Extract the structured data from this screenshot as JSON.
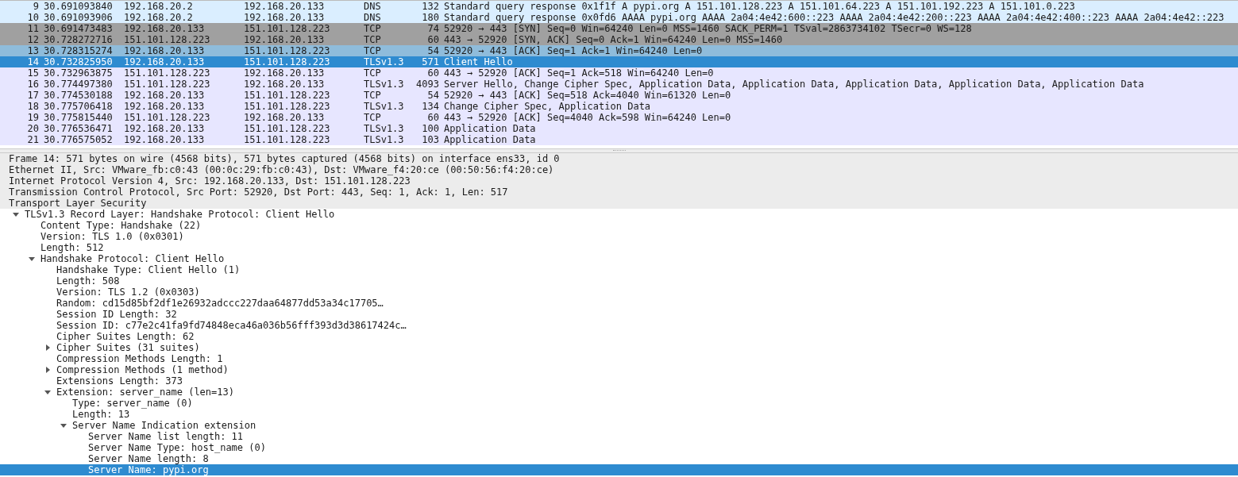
{
  "packets": [
    {
      "no": "9",
      "time": "30.691093840",
      "source": "192.168.20.2",
      "destination": "192.168.20.133",
      "protocol": "DNS",
      "length": "132",
      "info": "Standard query response 0x1f1f A pypi.org A 151.101.128.223 A 151.101.64.223 A 151.101.192.223 A 151.101.0.223",
      "color": "#daeeff",
      "selected": false
    },
    {
      "no": "10",
      "time": "30.691093906",
      "source": "192.168.20.2",
      "destination": "192.168.20.133",
      "protocol": "DNS",
      "length": "180",
      "info": "Standard query response 0x0fd6 AAAA pypi.org AAAA 2a04:4e42:600::223 AAAA 2a04:4e42:200::223 AAAA 2a04:4e42:400::223 AAAA 2a04:4e42::223",
      "color": "#daeeff",
      "selected": false
    },
    {
      "no": "11",
      "time": "30.691473483",
      "source": "192.168.20.133",
      "destination": "151.101.128.223",
      "protocol": "TCP",
      "length": "74",
      "info": "52920 → 443 [SYN] Seq=0 Win=64240 Len=0 MSS=1460 SACK_PERM=1 TSval=2863734102 TSecr=0 WS=128",
      "color": "#a0a0a0",
      "selected": false
    },
    {
      "no": "12",
      "time": "30.728272716",
      "source": "151.101.128.223",
      "destination": "192.168.20.133",
      "protocol": "TCP",
      "length": "60",
      "info": "443 → 52920 [SYN, ACK] Seq=0 Ack=1 Win=64240 Len=0 MSS=1460",
      "color": "#a0a0a0",
      "selected": false
    },
    {
      "no": "13",
      "time": "30.728315274",
      "source": "192.168.20.133",
      "destination": "151.101.128.223",
      "protocol": "TCP",
      "length": "54",
      "info": "52920 → 443 [ACK] Seq=1 Ack=1 Win=64240 Len=0",
      "color": "#8fbcdb",
      "selected": false
    },
    {
      "no": "14",
      "time": "30.732825950",
      "source": "192.168.20.133",
      "destination": "151.101.128.223",
      "protocol": "TLSv1.3",
      "length": "571",
      "info": "Client Hello",
      "color": "#2e8bd0",
      "selected": true
    },
    {
      "no": "15",
      "time": "30.732963875",
      "source": "151.101.128.223",
      "destination": "192.168.20.133",
      "protocol": "TCP",
      "length": "60",
      "info": "443 → 52920 [ACK] Seq=1 Ack=518 Win=64240 Len=0",
      "color": "#e7e6ff",
      "selected": false
    },
    {
      "no": "16",
      "time": "30.774497380",
      "source": "151.101.128.223",
      "destination": "192.168.20.133",
      "protocol": "TLSv1.3",
      "length": "4093",
      "info": "Server Hello, Change Cipher Spec, Application Data, Application Data, Application Data, Application Data, Application Data",
      "color": "#e7e6ff",
      "selected": false
    },
    {
      "no": "17",
      "time": "30.774530188",
      "source": "192.168.20.133",
      "destination": "151.101.128.223",
      "protocol": "TCP",
      "length": "54",
      "info": "52920 → 443 [ACK] Seq=518 Ack=4040 Win=61320 Len=0",
      "color": "#e7e6ff",
      "selected": false
    },
    {
      "no": "18",
      "time": "30.775706418",
      "source": "192.168.20.133",
      "destination": "151.101.128.223",
      "protocol": "TLSv1.3",
      "length": "134",
      "info": "Change Cipher Spec, Application Data",
      "color": "#e7e6ff",
      "selected": false
    },
    {
      "no": "19",
      "time": "30.775815440",
      "source": "151.101.128.223",
      "destination": "192.168.20.133",
      "protocol": "TCP",
      "length": "60",
      "info": "443 → 52920 [ACK] Seq=4040 Ack=598 Win=64240 Len=0",
      "color": "#e7e6ff",
      "selected": false
    },
    {
      "no": "20",
      "time": "30.776536471",
      "source": "192.168.20.133",
      "destination": "151.101.128.223",
      "protocol": "TLSv1.3",
      "length": "100",
      "info": "Application Data",
      "color": "#e7e6ff",
      "selected": false
    },
    {
      "no": "21",
      "time": "30.776575052",
      "source": "192.168.20.133",
      "destination": "151.101.128.223",
      "protocol": "TLSv1.3",
      "length": "103",
      "info": "Application Data",
      "color": "#e7e6ff",
      "selected": false
    }
  ],
  "details": [
    {
      "label": "Frame 14: 571 bytes on wire (4568 bits), 571 bytes captured (4568 bits) on interface ens33, id 0",
      "selected": false
    },
    {
      "label": "Ethernet II, Src: VMware_fb:c0:43 (00:0c:29:fb:c0:43), Dst: VMware_f4:20:ce (00:50:56:f4:20:ce)",
      "selected": false
    },
    {
      "label": "Internet Protocol Version 4, Src: 192.168.20.133, Dst: 151.101.128.223",
      "selected": false
    },
    {
      "label": "Transmission Control Protocol, Src Port: 52920, Dst Port: 443, Seq: 1, Ack: 1, Len: 517",
      "selected": false
    },
    {
      "label": "Transport Layer Security",
      "selected": false,
      "children": [
        {
          "label": "TLSv1.3 Record Layer: Handshake Protocol: Client Hello",
          "expanded": true,
          "selected": false,
          "children": [
            {
              "label": "Content Type: Handshake (22)",
              "selected": false
            },
            {
              "label": "Version: TLS 1.0 (0x0301)",
              "selected": false
            },
            {
              "label": "Length: 512",
              "selected": false
            },
            {
              "label": "Handshake Protocol: Client Hello",
              "expanded": true,
              "selected": false,
              "children": [
                {
                  "label": "Handshake Type: Client Hello (1)",
                  "selected": false
                },
                {
                  "label": "Length: 508",
                  "selected": false
                },
                {
                  "label": "Version: TLS 1.2 (0x0303)",
                  "selected": false
                },
                {
                  "label": "Random: cd15d85bf2df1e26932adccc227daa64877dd53a34c17705…",
                  "selected": false
                },
                {
                  "label": "Session ID Length: 32",
                  "selected": false
                },
                {
                  "label": "Session ID: c77e2c41fa9fd74848eca46a036b56fff393d3d38617424c…",
                  "selected": false
                },
                {
                  "label": "Cipher Suites Length: 62",
                  "selected": false
                },
                {
                  "label": "Cipher Suites (31 suites)",
                  "expanded": false,
                  "selected": false
                },
                {
                  "label": "Compression Methods Length: 1",
                  "selected": false
                },
                {
                  "label": "Compression Methods (1 method)",
                  "expanded": false,
                  "selected": false
                },
                {
                  "label": "Extensions Length: 373",
                  "selected": false
                },
                {
                  "label": "Extension: server_name (len=13)",
                  "expanded": true,
                  "selected": false,
                  "children": [
                    {
                      "label": "Type: server_name (0)",
                      "selected": false
                    },
                    {
                      "label": "Length: 13",
                      "selected": false
                    },
                    {
                      "label": "Server Name Indication extension",
                      "expanded": true,
                      "selected": false,
                      "children": [
                        {
                          "label": "Server Name list length: 11",
                          "selected": false
                        },
                        {
                          "label": "Server Name Type: host_name (0)",
                          "selected": false
                        },
                        {
                          "label": "Server Name length: 8",
                          "selected": false
                        },
                        {
                          "label": "Server Name: pypi.org",
                          "selected": true
                        }
                      ]
                    }
                  ]
                }
              ]
            }
          ]
        }
      ]
    }
  ]
}
